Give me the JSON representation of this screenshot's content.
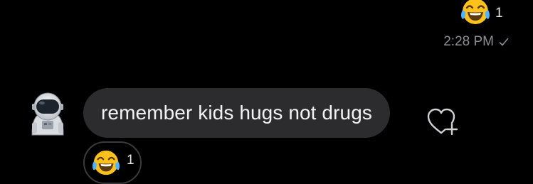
{
  "previous_message": {
    "reaction": {
      "emoji": "face-with-tears-of-joy-icon",
      "count": "1"
    },
    "timestamp": "2:28 PM",
    "read_status": "check-icon"
  },
  "incoming_message": {
    "avatar": "astronaut-avatar",
    "text": "remember kids hugs not drugs",
    "bubble_color": "#2c2c2e",
    "add_reaction_icon": "heart-plus-icon",
    "reaction": {
      "emoji": "face-with-tears-of-joy-icon",
      "count": "1"
    }
  },
  "colors": {
    "background": "#000000",
    "timestamp": "#8e8e93",
    "pill_border": "#3a3a3c"
  }
}
